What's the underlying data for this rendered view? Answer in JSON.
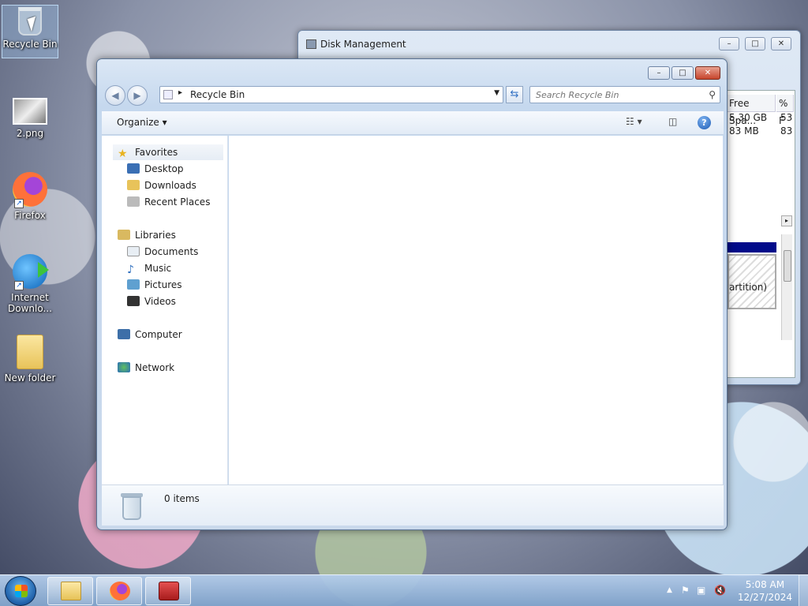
{
  "desktop": {
    "icons": [
      {
        "label": "Recycle Bin",
        "icon": "recycle-bin-icon"
      },
      {
        "label": "2.png",
        "icon": "image-file-icon"
      },
      {
        "label": "Firefox",
        "icon": "firefox-icon"
      },
      {
        "label": "Internet Downlo...",
        "icon": "idm-icon"
      },
      {
        "label": "New folder",
        "icon": "folder-icon"
      }
    ]
  },
  "disk_management": {
    "title": "Disk Management",
    "columns": [
      "Free Spa...",
      "% F"
    ],
    "rows": [
      [
        "5.30 GB",
        "53"
      ],
      [
        "83 MB",
        "83"
      ]
    ],
    "partition_label": "artition)"
  },
  "explorer": {
    "title": "",
    "controls": {
      "minimize": "–",
      "maximize": "□",
      "close": "✕"
    },
    "address": {
      "path": "Recycle Bin"
    },
    "search": {
      "placeholder": "Search Recycle Bin"
    },
    "toolbar": {
      "organize": "Organize"
    },
    "nav": {
      "favorites": "Favorites",
      "favorites_items": [
        "Desktop",
        "Downloads",
        "Recent Places"
      ],
      "libraries": "Libraries",
      "libraries_items": [
        "Documents",
        "Music",
        "Pictures",
        "Videos"
      ],
      "computer": "Computer",
      "network": "Network"
    },
    "status": {
      "count": "0 items"
    }
  },
  "taskbar": {
    "apps": [
      "Windows Explorer",
      "Firefox",
      "Tool"
    ],
    "time": "5:08 AM",
    "date": "12/27/2024"
  }
}
